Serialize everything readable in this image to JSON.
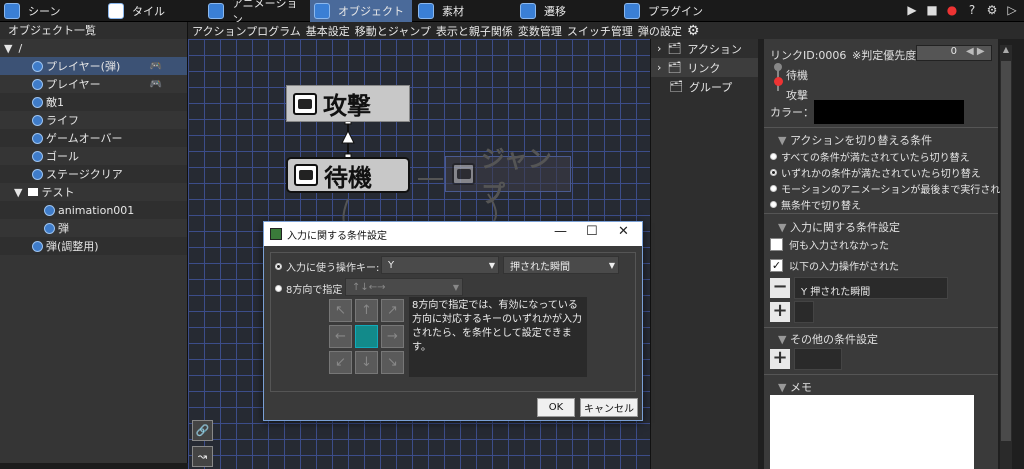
{
  "topbar": {
    "tabs": [
      {
        "label": "シーン",
        "icon": "scene-icon"
      },
      {
        "label": "タイル",
        "icon": "tile-icon"
      },
      {
        "label": "アニメーション",
        "icon": "animation-icon"
      },
      {
        "label": "オブジェクト",
        "icon": "object-icon"
      },
      {
        "label": "素材",
        "icon": "material-icon"
      },
      {
        "label": "遷移",
        "icon": "transition-icon"
      },
      {
        "label": "プラグイン",
        "icon": "plugin-icon"
      }
    ],
    "active_tab": "オブジェクト"
  },
  "objects_panel": {
    "title": "オブジェクト一覧",
    "root": "/",
    "items": [
      {
        "label": "プレイヤー(弾)",
        "selected": true,
        "gamepad": true
      },
      {
        "label": "プレイヤー",
        "gamepad": true
      },
      {
        "label": "敵1"
      },
      {
        "label": "ライフ"
      },
      {
        "label": "ゲームオーバー"
      },
      {
        "label": "ゴール"
      },
      {
        "label": "ステージクリア"
      },
      {
        "label": "テスト",
        "folder": true
      },
      {
        "label": "animation001"
      },
      {
        "label": "弾"
      },
      {
        "label": "弾(調整用)"
      }
    ]
  },
  "subtabs": [
    "アクションプログラム",
    "基本設定",
    "移動とジャンプ",
    "表示と親子関係",
    "変数管理",
    "スイッチ管理",
    "弾の設定"
  ],
  "canvas": {
    "nodes": [
      {
        "label": "攻撃"
      },
      {
        "label": "待機"
      },
      {
        "label": "ジャンプ"
      }
    ]
  },
  "side_list": {
    "items": [
      {
        "label": "アクション"
      },
      {
        "label": "リンク",
        "selected": true
      },
      {
        "label": "グループ"
      }
    ]
  },
  "link_panel": {
    "link_id": "リンクID:0006",
    "priority_label": "※判定優先度:",
    "priority_value": "0",
    "from": "待機",
    "to": "攻撃",
    "color_label": "カラー：",
    "section_switch": "アクションを切り替える条件",
    "switch_options": [
      {
        "label": "すべての条件が満たされていたら切り替え"
      },
      {
        "label": "いずれかの条件が満たされていたら切り替え",
        "selected": true
      },
      {
        "label": "モーションのアニメーションが最後まで実行され"
      },
      {
        "label": "無条件で切り替え"
      }
    ],
    "section_input": "入力に関する条件設定",
    "no_input_label": "何も入力されなかった",
    "no_input_checked": false,
    "input_done_label": "以下の入力操作がされた",
    "input_done_checked": true,
    "input_entry": "Y 押された瞬間",
    "section_other": "その他の条件設定",
    "section_memo": "メモ"
  },
  "dialog": {
    "title": "入力に関する条件設定",
    "key_label": "入力に使う操作キー:",
    "key_value": "Y",
    "key_state": "押された瞬間",
    "dir_label": "8方向で指定",
    "dir_placeholder": "↑↓←→",
    "description": "8方向で指定では、有効になっている方向に対応するキーのいずれかが入力されたら、を条件として設定できます。",
    "ok_label": "OK",
    "cancel_label": "キャンセル"
  },
  "colors": {
    "accent": "#3c5275",
    "grid": "#3c4d8a",
    "teal": "#128a8a"
  }
}
